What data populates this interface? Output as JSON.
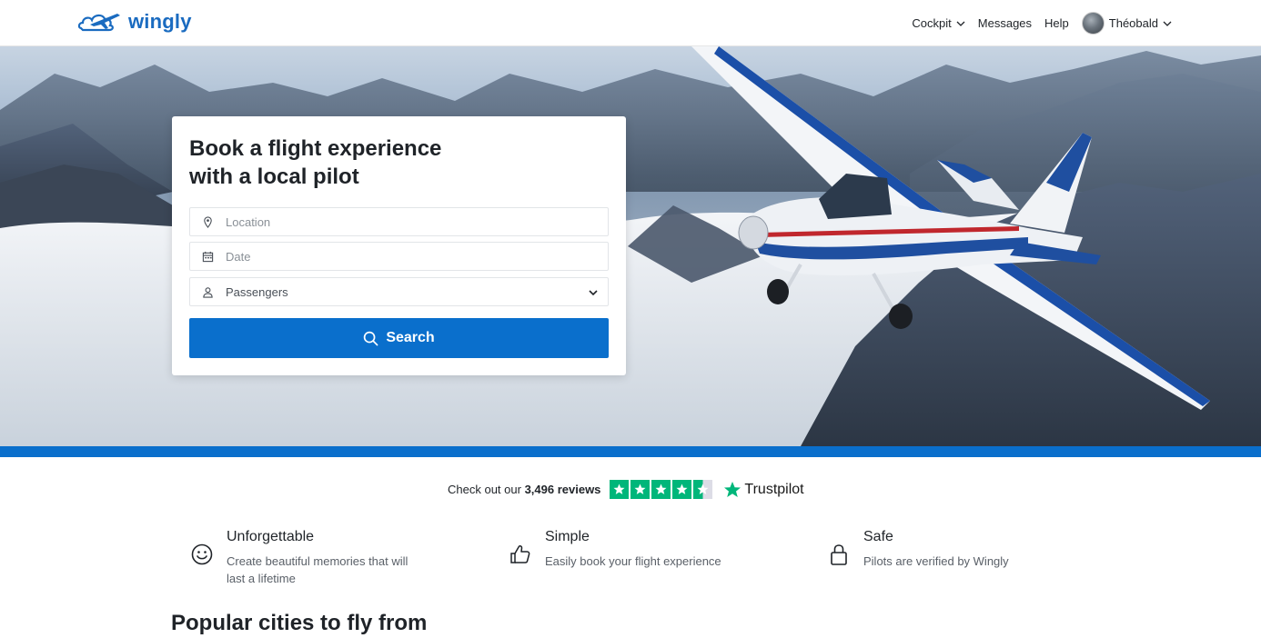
{
  "header": {
    "logo_text": "wingly",
    "nav": {
      "cockpit": "Cockpit",
      "messages": "Messages",
      "help": "Help",
      "user_name": "Théobald"
    }
  },
  "search_card": {
    "title_line1": "Book a flight experience",
    "title_line2": "with a local pilot",
    "location_placeholder": "Location",
    "date_placeholder": "Date",
    "passengers_label": "Passengers",
    "search_button": "Search"
  },
  "trustpilot": {
    "prefix": "Check out our",
    "reviews": "3,496 reviews",
    "brand": "Trustpilot",
    "stars": 4.5
  },
  "features": [
    {
      "title": "Unforgettable",
      "text": "Create beautiful memories that will last a lifetime",
      "icon": "smiley-icon"
    },
    {
      "title": "Simple",
      "text": "Easily book your flight experience",
      "icon": "thumbs-up-icon"
    },
    {
      "title": "Safe",
      "text": "Pilots are verified by Wingly",
      "icon": "lock-icon"
    }
  ],
  "popular_title": "Popular cities to fly from",
  "colors": {
    "brand_blue": "#0a6fcc",
    "logo_blue": "#1a6bc0",
    "trustpilot_green": "#00b67a"
  }
}
